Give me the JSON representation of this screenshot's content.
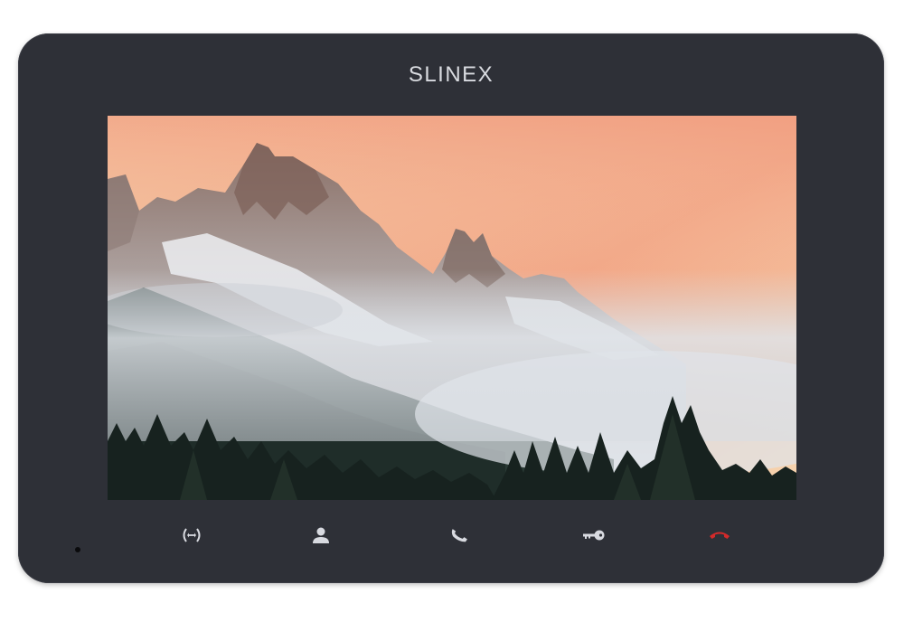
{
  "device": {
    "brand": "SLINEX",
    "colors": {
      "body": "#2e3037",
      "icon": "#d8dae0",
      "hangup": "#d42a2a"
    }
  },
  "buttons": [
    {
      "id": "intercom",
      "icon": "intercom-arrows-icon"
    },
    {
      "id": "user",
      "icon": "user-icon"
    },
    {
      "id": "answer",
      "icon": "phone-answer-icon"
    },
    {
      "id": "unlock",
      "icon": "key-icon"
    },
    {
      "id": "hangup",
      "icon": "phone-hangup-icon"
    }
  ]
}
